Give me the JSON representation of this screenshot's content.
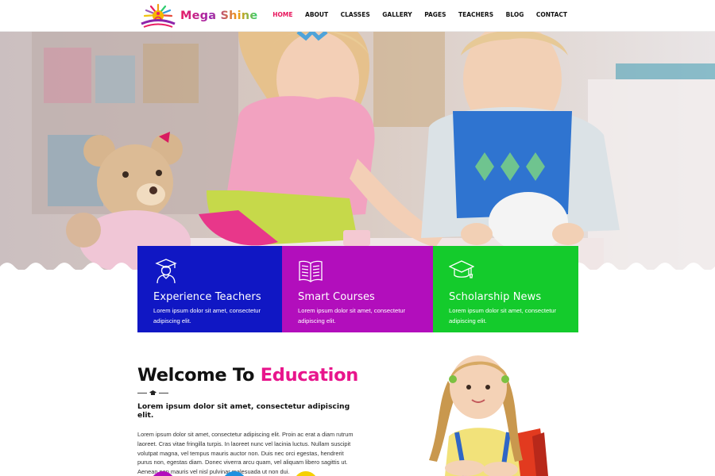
{
  "brand": {
    "name": "Mega Shine"
  },
  "nav": {
    "items": [
      {
        "label": "HOME",
        "active": true
      },
      {
        "label": "ABOUT",
        "active": false
      },
      {
        "label": "CLASSES",
        "active": false
      },
      {
        "label": "GALLERY",
        "active": false
      },
      {
        "label": "PAGES",
        "active": false
      },
      {
        "label": "TEACHERS",
        "active": false
      },
      {
        "label": "BLOG",
        "active": false
      },
      {
        "label": "CONTACT",
        "active": false
      }
    ]
  },
  "features": [
    {
      "title": "Experience Teachers",
      "text": "Lorem ipsum dolor sit amet, consectetur adipiscing elit.",
      "color": "#1017c4",
      "icon": "teacher-icon"
    },
    {
      "title": "Smart Courses",
      "text": "Lorem ipsum dolor sit amet, consectetur adipiscing elit.",
      "color": "#b20ebc",
      "icon": "book-icon"
    },
    {
      "title": "Scholarship News",
      "text": "Lorem ipsum dolor sit amet, consectetur adipiscing elit.",
      "color": "#14cb2c",
      "icon": "graduation-cap-icon"
    }
  ],
  "welcome": {
    "title_part1": "Welcome To ",
    "title_highlight": "Education",
    "subtitle": "Lorem ipsum dolor sit amet, consectetur adipiscing elit.",
    "body": "Lorem ipsum dolor sit amet, consectetur adipiscing elit. Proin ac erat a diam rutrum laoreet. Cras vitae fringilla turpis. In laoreet nunc vel lacinia luctus. Nullam suscipit volutpat magna, vel tempus mauris auctor non. Duis nec orci egestas, hendrerit purus non, egestas diam. Donec viverra arcu quam, vel aliquam libero sagittis ut. Aenean non mauris vel nisl pulvinar malesuada ut non dui."
  },
  "colors": {
    "accent": "#e8155c",
    "highlight": "#e8158c"
  }
}
